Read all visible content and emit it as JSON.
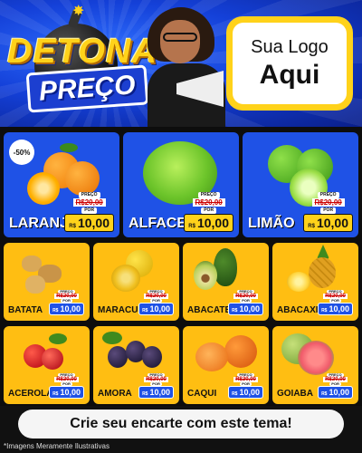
{
  "header": {
    "title_line1": "DETONA",
    "title_line2": "PREÇO",
    "logo_line1": "Sua Logo",
    "logo_line2": "Aqui"
  },
  "discount_badge": "-50%",
  "price_labels": {
    "price_tag": "PREÇO",
    "old_price": "20,00",
    "old_prefix": "R$",
    "by_tag": "POR",
    "currency": "R$"
  },
  "products_featured": [
    {
      "name": "LARANJA",
      "price": "10,00"
    },
    {
      "name": "ALFACE",
      "price": "10,00"
    },
    {
      "name": "LIMÃO",
      "price": "10,00"
    }
  ],
  "products_row2": [
    {
      "name": "BATATA",
      "price": "10,00"
    },
    {
      "name": "MARACUJÁ",
      "price": "10,00"
    },
    {
      "name": "ABACATE",
      "price": "10,00"
    },
    {
      "name": "ABACAXI",
      "price": "10,00"
    }
  ],
  "products_row3": [
    {
      "name": "ACEROLA",
      "price": "10,00"
    },
    {
      "name": "AMORA",
      "price": "10,00"
    },
    {
      "name": "CAQUI",
      "price": "10,00"
    },
    {
      "name": "GOIABA",
      "price": "10,00"
    }
  ],
  "footer": {
    "cta": "Crie seu encarte com este tema!",
    "disclaimer": "*Imagens Meramente Ilustrativas"
  },
  "colors": {
    "header_blue": "#1440d8",
    "featured_card": "#1f52e6",
    "small_card": "#ffbe12",
    "brand_yellow": "#ffd21a"
  }
}
